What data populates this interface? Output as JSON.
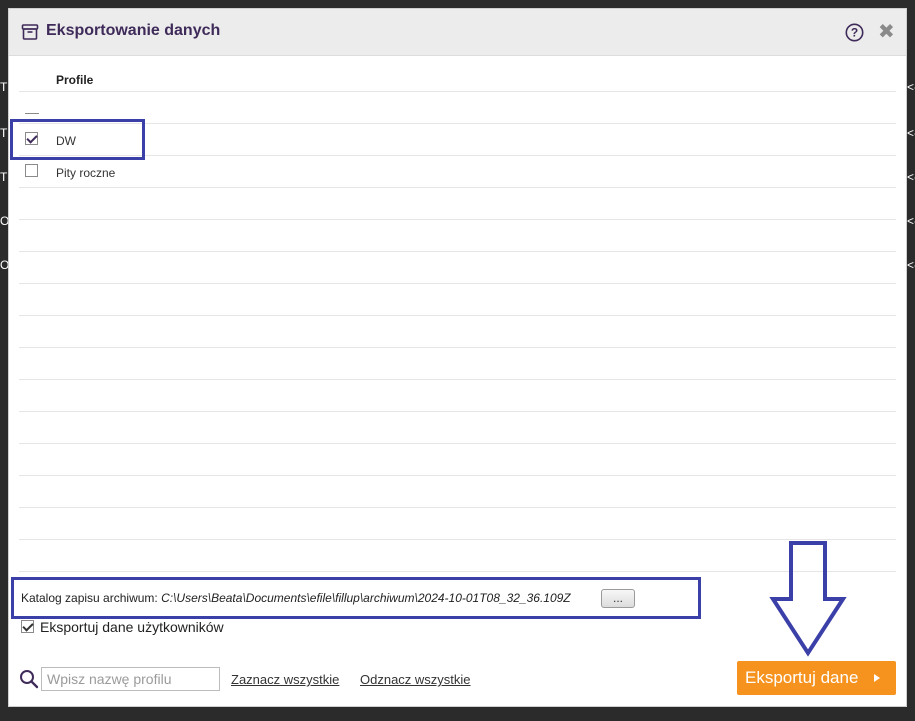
{
  "background_fragments": {
    "left": [
      "T",
      "T",
      "T",
      "O",
      "O"
    ],
    "right": [
      "<-",
      "<-",
      "<-",
      "<-",
      "<-"
    ]
  },
  "dialog": {
    "title": "Eksportowanie danych",
    "title_icon": "archive-box-icon",
    "help_icon": "help-circle-icon",
    "close_icon": "close-icon",
    "close_glyph": "✖"
  },
  "profiles": {
    "column_header": "Profile",
    "rows": [
      {
        "label": "",
        "checked": false,
        "partial": true
      },
      {
        "label": "DW",
        "checked": true
      },
      {
        "label": "Pity roczne",
        "checked": false
      }
    ]
  },
  "archive": {
    "label": "Katalog zapisu archiwum:",
    "path": "C:\\Users\\Beata\\Documents\\efile\\fillup\\archiwum\\2024-10-01T08_32_36.109Z",
    "browse_label": "..."
  },
  "options": {
    "export_users_label": "Eksportuj dane użytkowników",
    "export_users_checked": true
  },
  "footer": {
    "search_placeholder": "Wpisz nazwę profilu",
    "select_all": "Zaznacz wszystkie",
    "deselect_all": "Odznacz wszystkie",
    "export_button": "Eksportuj dane"
  },
  "colors": {
    "accent_purple": "#3f2b5a",
    "highlight_blue": "#3b3fa8",
    "export_orange": "#f6921e"
  }
}
